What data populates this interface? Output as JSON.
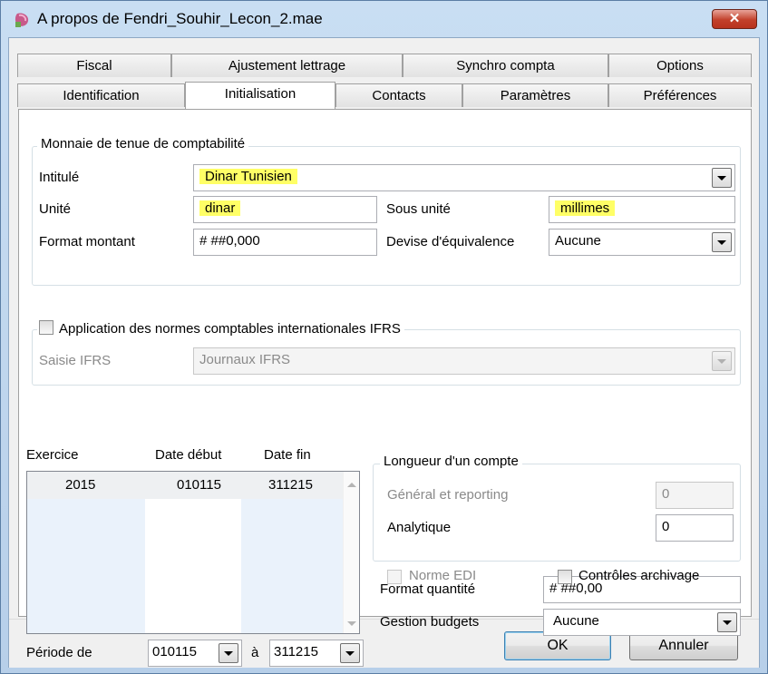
{
  "window": {
    "title": "A propos de Fendri_Souhir_Lecon_2.mae",
    "close_glyph": "✕"
  },
  "tabs_row1": [
    "Fiscal",
    "Ajustement lettrage",
    "Synchro compta",
    "Options"
  ],
  "tabs_row2": [
    "Identification",
    "Initialisation",
    "Contacts",
    "Paramètres",
    "Préférences"
  ],
  "active_tab": "Initialisation",
  "monnaie": {
    "legend": "Monnaie de tenue de comptabilité",
    "intitule_label": "Intitulé",
    "intitule_value": "Dinar Tunisien",
    "unite_label": "Unité",
    "unite_value": "dinar",
    "sous_unite_label": "Sous unité",
    "sous_unite_value": "millimes",
    "format_label": "Format montant",
    "format_value": "# ##0,000",
    "devise_label": "Devise d'équivalence",
    "devise_value": "Aucune"
  },
  "ifrs": {
    "checkbox_label": "Application des normes comptables internationales IFRS",
    "checked": false,
    "saisie_label": "Saisie IFRS",
    "saisie_value": "Journaux IFRS"
  },
  "exercices": {
    "headers": [
      "Exercice",
      "Date début",
      "Date fin"
    ],
    "rows": [
      {
        "exercice": "2015",
        "debut": "010115",
        "fin": "311215"
      }
    ]
  },
  "periode": {
    "label": "Période de",
    "from": "010115",
    "to_label": "à",
    "to": "311215"
  },
  "longueur": {
    "legend": "Longueur d'un compte",
    "general_label": "Général et reporting",
    "general_value": "0",
    "analytique_label": "Analytique",
    "analytique_value": "0"
  },
  "format_quantite": {
    "label": "Format quantité",
    "value": "# ##0,00"
  },
  "gestion_budgets": {
    "label": "Gestion budgets",
    "value": "Aucune"
  },
  "norme_edi": {
    "label": "Norme EDI",
    "checked": false
  },
  "controles_archivage": {
    "label": "Contrôles archivage",
    "checked": false
  },
  "buttons": {
    "ok": "OK",
    "cancel": "Annuler"
  },
  "colors": {
    "highlight": "#ffff66",
    "titlebar": "#c9def3",
    "close": "#c2402a"
  }
}
